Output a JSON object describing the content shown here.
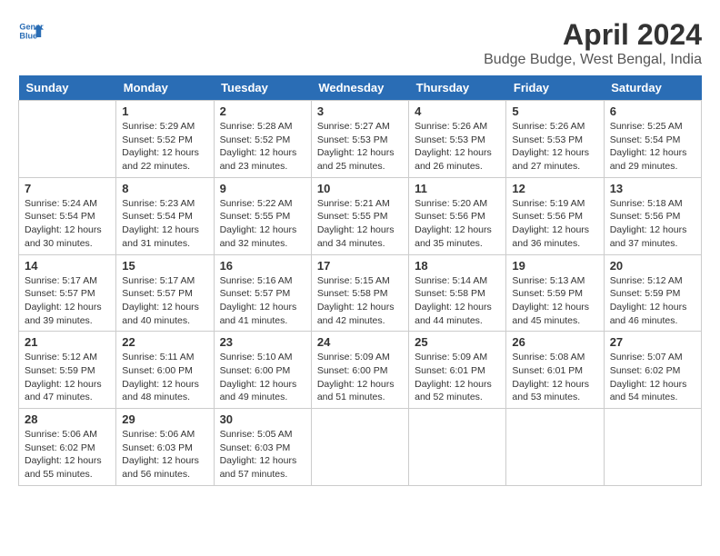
{
  "logo": {
    "line1": "General",
    "line2": "Blue"
  },
  "title": "April 2024",
  "subtitle": "Budge Budge, West Bengal, India",
  "weekdays": [
    "Sunday",
    "Monday",
    "Tuesday",
    "Wednesday",
    "Thursday",
    "Friday",
    "Saturday"
  ],
  "weeks": [
    [
      {
        "day": "",
        "info": ""
      },
      {
        "day": "1",
        "info": "Sunrise: 5:29 AM\nSunset: 5:52 PM\nDaylight: 12 hours\nand 22 minutes."
      },
      {
        "day": "2",
        "info": "Sunrise: 5:28 AM\nSunset: 5:52 PM\nDaylight: 12 hours\nand 23 minutes."
      },
      {
        "day": "3",
        "info": "Sunrise: 5:27 AM\nSunset: 5:53 PM\nDaylight: 12 hours\nand 25 minutes."
      },
      {
        "day": "4",
        "info": "Sunrise: 5:26 AM\nSunset: 5:53 PM\nDaylight: 12 hours\nand 26 minutes."
      },
      {
        "day": "5",
        "info": "Sunrise: 5:26 AM\nSunset: 5:53 PM\nDaylight: 12 hours\nand 27 minutes."
      },
      {
        "day": "6",
        "info": "Sunrise: 5:25 AM\nSunset: 5:54 PM\nDaylight: 12 hours\nand 29 minutes."
      }
    ],
    [
      {
        "day": "7",
        "info": "Sunrise: 5:24 AM\nSunset: 5:54 PM\nDaylight: 12 hours\nand 30 minutes."
      },
      {
        "day": "8",
        "info": "Sunrise: 5:23 AM\nSunset: 5:54 PM\nDaylight: 12 hours\nand 31 minutes."
      },
      {
        "day": "9",
        "info": "Sunrise: 5:22 AM\nSunset: 5:55 PM\nDaylight: 12 hours\nand 32 minutes."
      },
      {
        "day": "10",
        "info": "Sunrise: 5:21 AM\nSunset: 5:55 PM\nDaylight: 12 hours\nand 34 minutes."
      },
      {
        "day": "11",
        "info": "Sunrise: 5:20 AM\nSunset: 5:56 PM\nDaylight: 12 hours\nand 35 minutes."
      },
      {
        "day": "12",
        "info": "Sunrise: 5:19 AM\nSunset: 5:56 PM\nDaylight: 12 hours\nand 36 minutes."
      },
      {
        "day": "13",
        "info": "Sunrise: 5:18 AM\nSunset: 5:56 PM\nDaylight: 12 hours\nand 37 minutes."
      }
    ],
    [
      {
        "day": "14",
        "info": "Sunrise: 5:17 AM\nSunset: 5:57 PM\nDaylight: 12 hours\nand 39 minutes."
      },
      {
        "day": "15",
        "info": "Sunrise: 5:17 AM\nSunset: 5:57 PM\nDaylight: 12 hours\nand 40 minutes."
      },
      {
        "day": "16",
        "info": "Sunrise: 5:16 AM\nSunset: 5:57 PM\nDaylight: 12 hours\nand 41 minutes."
      },
      {
        "day": "17",
        "info": "Sunrise: 5:15 AM\nSunset: 5:58 PM\nDaylight: 12 hours\nand 42 minutes."
      },
      {
        "day": "18",
        "info": "Sunrise: 5:14 AM\nSunset: 5:58 PM\nDaylight: 12 hours\nand 44 minutes."
      },
      {
        "day": "19",
        "info": "Sunrise: 5:13 AM\nSunset: 5:59 PM\nDaylight: 12 hours\nand 45 minutes."
      },
      {
        "day": "20",
        "info": "Sunrise: 5:12 AM\nSunset: 5:59 PM\nDaylight: 12 hours\nand 46 minutes."
      }
    ],
    [
      {
        "day": "21",
        "info": "Sunrise: 5:12 AM\nSunset: 5:59 PM\nDaylight: 12 hours\nand 47 minutes."
      },
      {
        "day": "22",
        "info": "Sunrise: 5:11 AM\nSunset: 6:00 PM\nDaylight: 12 hours\nand 48 minutes."
      },
      {
        "day": "23",
        "info": "Sunrise: 5:10 AM\nSunset: 6:00 PM\nDaylight: 12 hours\nand 49 minutes."
      },
      {
        "day": "24",
        "info": "Sunrise: 5:09 AM\nSunset: 6:00 PM\nDaylight: 12 hours\nand 51 minutes."
      },
      {
        "day": "25",
        "info": "Sunrise: 5:09 AM\nSunset: 6:01 PM\nDaylight: 12 hours\nand 52 minutes."
      },
      {
        "day": "26",
        "info": "Sunrise: 5:08 AM\nSunset: 6:01 PM\nDaylight: 12 hours\nand 53 minutes."
      },
      {
        "day": "27",
        "info": "Sunrise: 5:07 AM\nSunset: 6:02 PM\nDaylight: 12 hours\nand 54 minutes."
      }
    ],
    [
      {
        "day": "28",
        "info": "Sunrise: 5:06 AM\nSunset: 6:02 PM\nDaylight: 12 hours\nand 55 minutes."
      },
      {
        "day": "29",
        "info": "Sunrise: 5:06 AM\nSunset: 6:03 PM\nDaylight: 12 hours\nand 56 minutes."
      },
      {
        "day": "30",
        "info": "Sunrise: 5:05 AM\nSunset: 6:03 PM\nDaylight: 12 hours\nand 57 minutes."
      },
      {
        "day": "",
        "info": ""
      },
      {
        "day": "",
        "info": ""
      },
      {
        "day": "",
        "info": ""
      },
      {
        "day": "",
        "info": ""
      }
    ]
  ]
}
